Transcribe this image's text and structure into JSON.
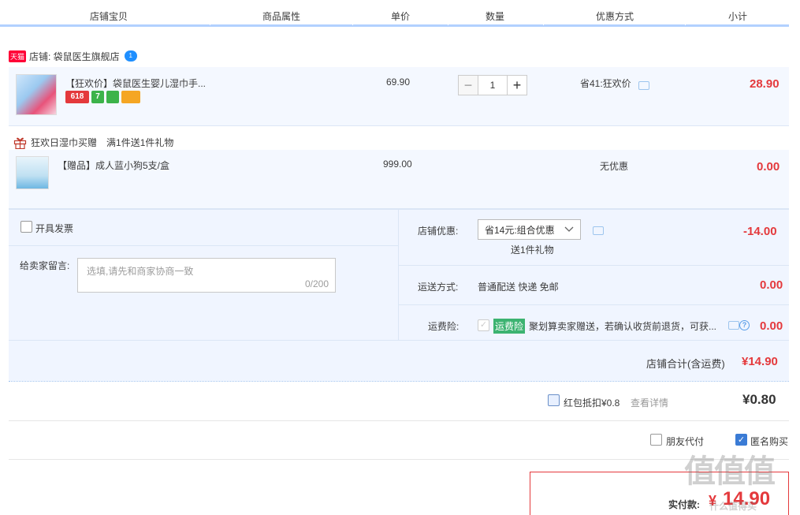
{
  "header": {
    "cols": [
      "店铺宝贝",
      "商品属性",
      "单价",
      "数量",
      "优惠方式",
      "小计"
    ]
  },
  "shop": {
    "tag": "天猫",
    "label": "店铺: 袋鼠医生旗舰店",
    "chat_badge": "1"
  },
  "item1": {
    "title": "【狂欢价】袋鼠医生婴儿湿巾手...",
    "badges": [
      "618",
      "7",
      "",
      ""
    ],
    "unit_price": "69.90",
    "quantity": "1",
    "discount": "省41:狂欢价",
    "subtotal": "28.90"
  },
  "promo": {
    "label": "狂欢日湿巾买赠",
    "detail": "满1件送1件礼物"
  },
  "gift": {
    "title": "【赠品】成人蓝小狗5支/盒",
    "unit_price": "999.00",
    "discount": "无优惠",
    "subtotal": "0.00"
  },
  "invoice": {
    "label": "开具发票"
  },
  "message": {
    "label": "给卖家留言:",
    "placeholder": "选填,请先和商家协商一致",
    "counter": "0/200"
  },
  "shop_discount": {
    "label": "店铺优惠:",
    "selected": "省14元:组合优惠",
    "note": "送1件礼物",
    "amount": "-14.00"
  },
  "shipping": {
    "label": "运送方式:",
    "value": "普通配送 快递 免邮",
    "amount": "0.00"
  },
  "insurance": {
    "label": "运费险:",
    "tag": "运费险",
    "text": "聚划算卖家赠送，若确认收货前退货，可获...",
    "amount": "0.00"
  },
  "shop_total": {
    "label": "店铺合计(含运费)",
    "amount": "¥14.90"
  },
  "redpacket": {
    "label": "红包抵扣¥0.8",
    "link": "查看详情",
    "amount": "¥0.80"
  },
  "options": {
    "friend_pay": "朋友代付",
    "anonymous": "匿名购买"
  },
  "payment": {
    "label": "实付款:",
    "currency": "¥",
    "amount": "14.90"
  },
  "watermark": {
    "logo": "值值值",
    "site": "什么值得买"
  }
}
